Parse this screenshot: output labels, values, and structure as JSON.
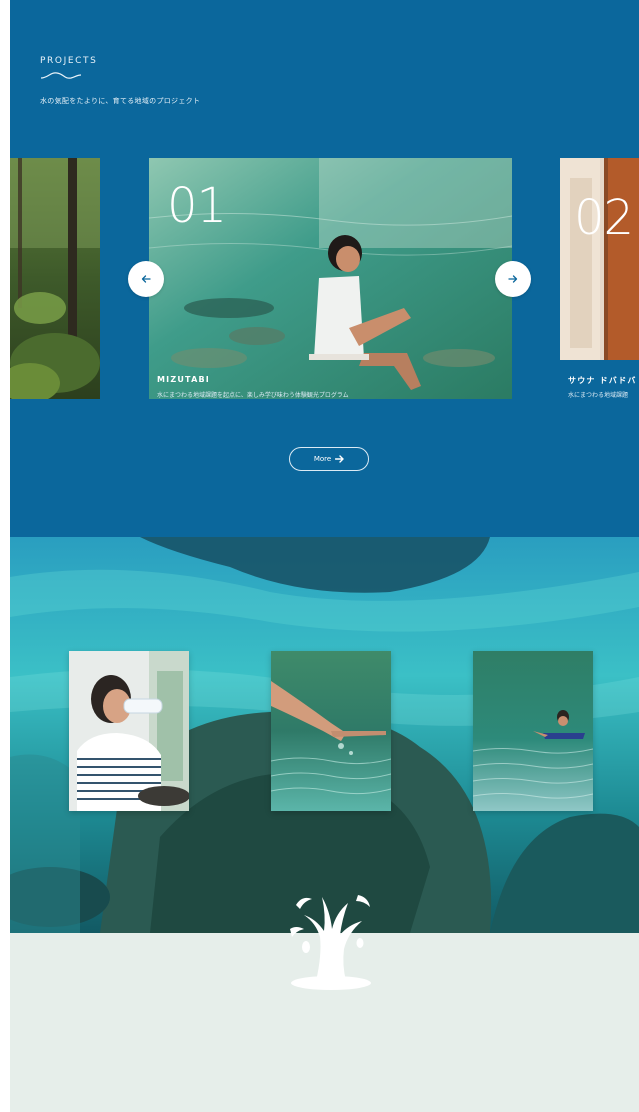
{
  "projects": {
    "heading": "PROJECTS",
    "subtitle": "水の気配をたよりに、育てる地域のプロジェクト",
    "more_label": "More"
  },
  "slides": [
    {
      "number": "01",
      "title": "MIZUTABI",
      "description": "水にまつわる地域課題を起点に、楽しみ学び味わう体験観光プログラム"
    },
    {
      "number": "02",
      "title": "サウナ ドバドバ",
      "description": "水にまつわる地域課題"
    }
  ],
  "colors": {
    "projects_bg": "#0b679c",
    "footer_bg": "#e6eeea",
    "accent": "#ffffff"
  },
  "icons": {
    "prev": "arrow-left-icon",
    "next": "arrow-right-icon",
    "more": "arrow-right-icon",
    "splash": "water-splash-icon"
  }
}
